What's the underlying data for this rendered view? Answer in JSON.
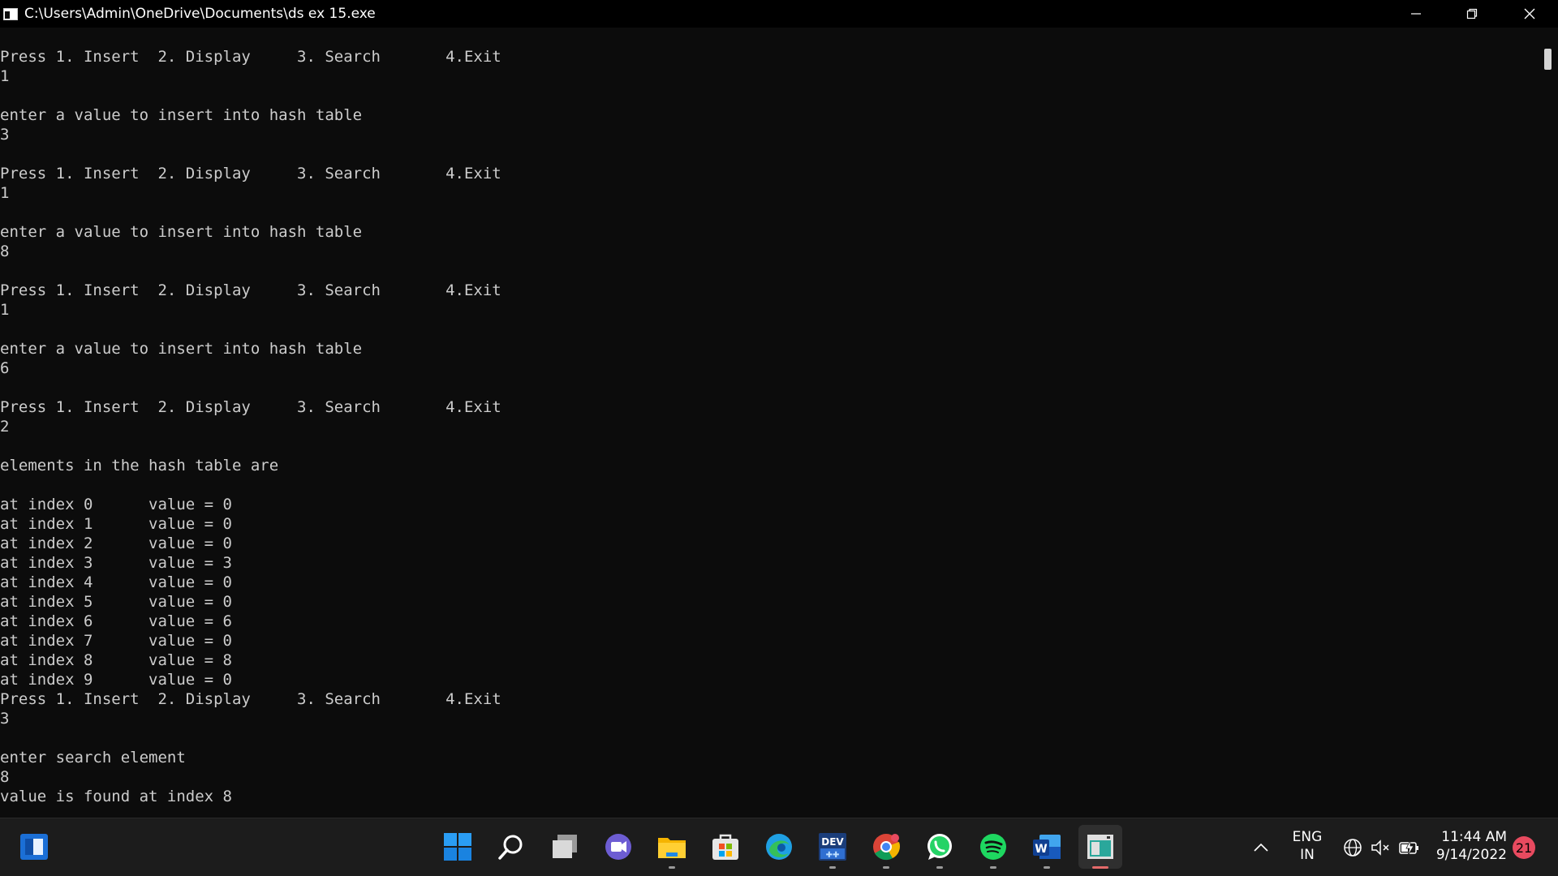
{
  "window": {
    "title": "C:\\Users\\Admin\\OneDrive\\Documents\\ds ex 15.exe"
  },
  "console": {
    "lines": [
      "Press 1. Insert  2. Display     3. Search       4.Exit",
      "1",
      "",
      "enter a value to insert into hash table",
      "3",
      "",
      "Press 1. Insert  2. Display     3. Search       4.Exit",
      "1",
      "",
      "enter a value to insert into hash table",
      "8",
      "",
      "Press 1. Insert  2. Display     3. Search       4.Exit",
      "1",
      "",
      "enter a value to insert into hash table",
      "6",
      "",
      "Press 1. Insert  2. Display     3. Search       4.Exit",
      "2",
      "",
      "elements in the hash table are",
      "",
      "at index 0      value = 0",
      "at index 1      value = 0",
      "at index 2      value = 0",
      "at index 3      value = 3",
      "at index 4      value = 0",
      "at index 5      value = 0",
      "at index 6      value = 6",
      "at index 7      value = 0",
      "at index 8      value = 8",
      "at index 9      value = 0",
      "Press 1. Insert  2. Display     3. Search       4.Exit",
      "3",
      "",
      "enter search element",
      "8",
      "value is found at index 8"
    ]
  },
  "taskbar": {
    "apps": [
      {
        "name": "start-button",
        "icon": "windows-logo-icon"
      },
      {
        "name": "search-button",
        "icon": "search-icon"
      },
      {
        "name": "task-view-button",
        "icon": "task-view-icon"
      },
      {
        "name": "chat-button",
        "icon": "teams-chat-icon"
      },
      {
        "name": "file-explorer-button",
        "icon": "folder-icon"
      },
      {
        "name": "microsoft-store-button",
        "icon": "store-icon"
      },
      {
        "name": "edge-button",
        "icon": "edge-icon"
      },
      {
        "name": "dev-cpp-button",
        "icon": "dev-cpp-icon"
      },
      {
        "name": "chrome-button",
        "icon": "chrome-icon"
      },
      {
        "name": "whatsapp-button",
        "icon": "whatsapp-icon"
      },
      {
        "name": "spotify-button",
        "icon": "spotify-icon"
      },
      {
        "name": "word-button",
        "icon": "word-icon"
      },
      {
        "name": "console-app-button",
        "icon": "console-window-icon"
      }
    ],
    "dev_icon_label": "DEV",
    "word_icon_label": "W",
    "language": {
      "line1": "ENG",
      "line2": "IN"
    },
    "clock": {
      "time": "11:44 AM",
      "date": "9/14/2022"
    },
    "notification_count": "21",
    "colors": {
      "console_bg": "#0c0c0c",
      "console_text": "#cccccc",
      "taskbar_bg": "#1c1c1c",
      "badge": "#e84a5f",
      "active_indicator": "#e46a6a"
    }
  }
}
